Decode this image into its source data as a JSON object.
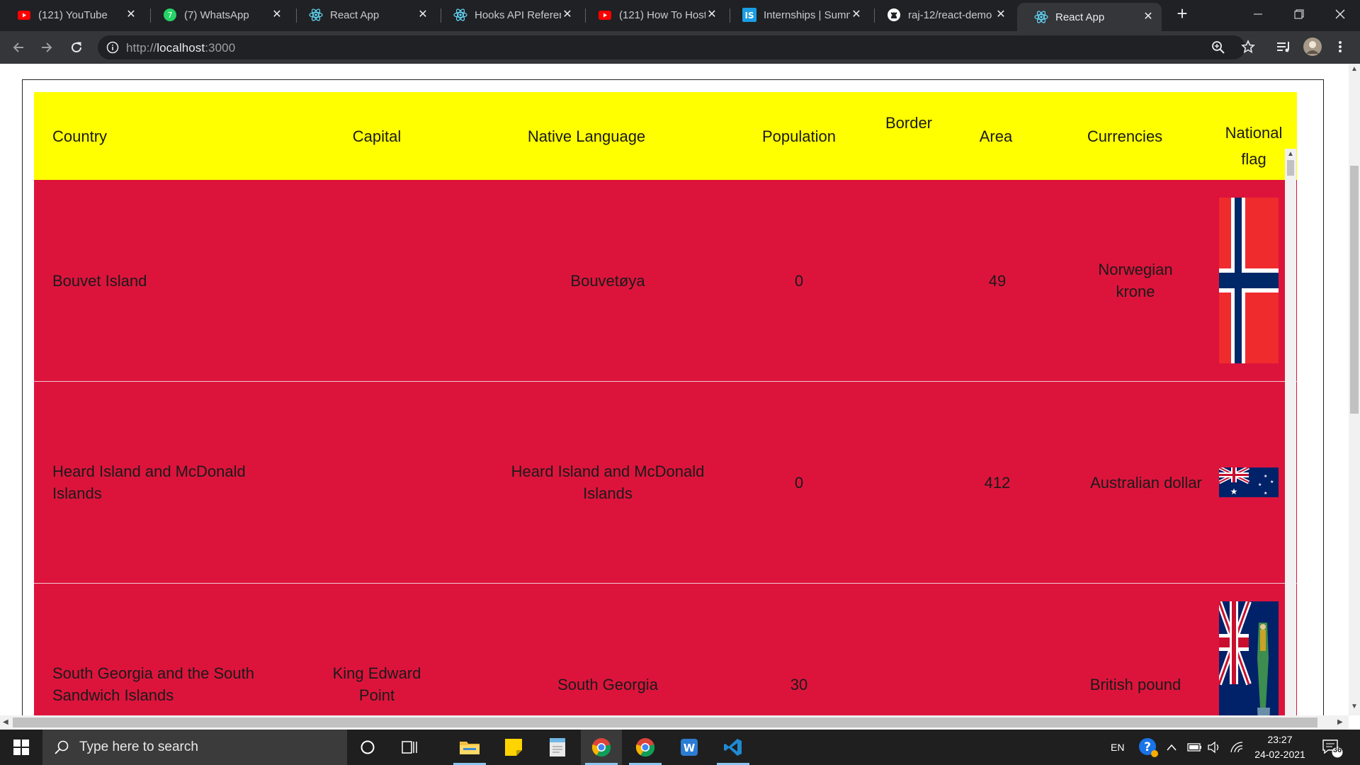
{
  "browser": {
    "tabs": [
      {
        "title": "(121) YouTube",
        "icon": "youtube-icon"
      },
      {
        "title": "(7) WhatsApp",
        "icon": "whatsapp-icon"
      },
      {
        "title": "React App",
        "icon": "react-icon"
      },
      {
        "title": "Hooks API Referen",
        "icon": "react-icon"
      },
      {
        "title": "(121) How To Host",
        "icon": "youtube-icon"
      },
      {
        "title": "Internships | Summ",
        "icon": "internshala-icon"
      },
      {
        "title": "raj-12/react-demo",
        "icon": "github-icon"
      },
      {
        "title": "React App",
        "icon": "react-icon"
      }
    ],
    "active_tab": 7,
    "url_scheme": "http://",
    "url_host": "localhost",
    "url_port": ":3000"
  },
  "table": {
    "headers": {
      "country": "Country",
      "capital": "Capital",
      "native_language": "Native Language",
      "population": "Population",
      "border": "Border",
      "area": "Area",
      "currencies": "Currencies",
      "flag_line1": "National",
      "flag_line2": "flag"
    },
    "rows": [
      {
        "country": "Bouvet Island",
        "capital": "",
        "native_language": "Bouvetøya",
        "population": "0",
        "border": "",
        "area": "49",
        "currencies": "Norwegian krone",
        "flag": "norway-flag"
      },
      {
        "country": "Heard Island and McDonald Islands",
        "capital": "",
        "native_language": "Heard Island and McDonald Islands",
        "population": "0",
        "border": "",
        "area": "412",
        "currencies": "Australian dollar",
        "flag": "australia-flag"
      },
      {
        "country": "South Georgia and the South Sandwich Islands",
        "capital": "King Edward Point",
        "native_language": "South Georgia",
        "population": "30",
        "border": "",
        "area": "",
        "currencies": "British pound",
        "flag": "south-georgia-flag"
      }
    ],
    "colors": {
      "header_bg": "#ffff00",
      "row_bg": "#dc143c"
    }
  },
  "taskbar": {
    "search_placeholder": "Type here to search",
    "language": "EN",
    "time": "23:27",
    "date": "24-02-2021",
    "notification_count": "36"
  }
}
